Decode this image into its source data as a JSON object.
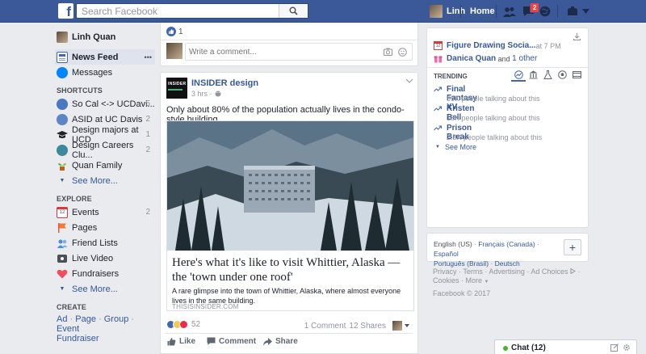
{
  "topbar": {
    "logo": "f",
    "search_placeholder": "Search Facebook",
    "user_name": "Linh",
    "home": "Home",
    "messages_badge": "2"
  },
  "leftnav": {
    "user": "Linh Quan",
    "main": [
      {
        "label": "News Feed",
        "selected": true,
        "icon": "news-feed-icon"
      },
      {
        "label": "Messages",
        "icon": "messages-icon"
      }
    ],
    "more_glyph": "•••",
    "shortcuts_heading": "SHORTCUTS",
    "shortcuts": [
      {
        "label": "So Cal <-> UCDavi...",
        "count": "5"
      },
      {
        "label": "ASID at UC Davis",
        "count": "2"
      },
      {
        "label": "Design majors at UCD",
        "count": "1"
      },
      {
        "label": "Design Careers Clu...",
        "count": "2"
      },
      {
        "label": "Quan Family",
        "count": ""
      }
    ],
    "see_more": "See More...",
    "explore_heading": "EXPLORE",
    "explore": [
      {
        "label": "Events",
        "count": "2",
        "icon": "calendar-icon",
        "icon_text": "12"
      },
      {
        "label": "Pages",
        "count": "",
        "icon": "flag-icon"
      },
      {
        "label": "Friend Lists",
        "count": "",
        "icon": "friend-lists-icon"
      },
      {
        "label": "Live Video",
        "count": "",
        "icon": "live-video-icon"
      },
      {
        "label": "Fundraisers",
        "count": "",
        "icon": "heart-icon"
      }
    ],
    "create_heading": "CREATE",
    "create_links": [
      "Ad",
      "Page",
      "Group",
      "Event",
      "Fundraiser"
    ],
    "create_sep": " · "
  },
  "feed": {
    "prev_like_count": "1",
    "comment_placeholder": "Write a comment...",
    "post": {
      "page_name": "INSIDER design",
      "logo_text": "INSIDER",
      "time": "3 hrs ·",
      "text": "Only about 80% of the population actually lives in the condo-style building.",
      "link_title": "Here's what it's like to visit Whittier, Alaska — the 'town under one roof'",
      "link_desc": "A rare glimpse into the town of Whittier, Alaska, where almost everyone lives in the same building.",
      "link_domain": "THISISINSIDER.COM",
      "reaction_count": "52",
      "comments": "1 Comment",
      "shares": "12 Shares",
      "actions": [
        "Like",
        "Comment",
        "Share"
      ]
    }
  },
  "right": {
    "events": [
      {
        "title": "Figure Drawing Socia...",
        "suffix": " at 7 PM",
        "icon_text": "12"
      },
      {
        "title": "Danica Quan",
        "suffix": " and ",
        "extra": "1 other"
      }
    ],
    "trending_heading": "TRENDING",
    "trending": [
      {
        "title": "Final Fantasy XV",
        "sub": "69K people talking about this"
      },
      {
        "title": "Kristen Bell",
        "sub": "18K people talking about this"
      },
      {
        "title": "Prison Break",
        "sub": "2.8K people talking about this"
      }
    ],
    "see_more": "See More",
    "languages": {
      "line1": [
        "English (US)",
        "Français (Canada)",
        "Español"
      ],
      "line2": [
        "Português (Brasil)",
        "Deutsch"
      ],
      "sep": " · ",
      "add": "+"
    },
    "footer_links": [
      "Privacy",
      "Terms",
      "Advertising",
      "Ad Choices",
      "Cookies",
      "More"
    ],
    "footer_sep": " · ",
    "copyright": "Facebook © 2017"
  },
  "chat": {
    "label": "Chat (12)",
    "status_color": "#42b72a"
  },
  "colors": {
    "brand": "#3b5998",
    "link": "#365899",
    "like": "#4267b2"
  }
}
